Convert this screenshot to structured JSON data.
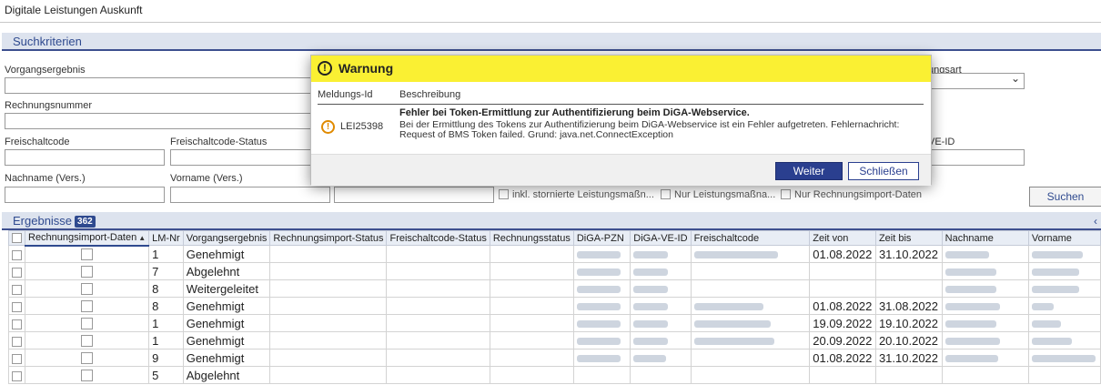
{
  "app": {
    "title": "Digitale Leistungen Auskunft"
  },
  "search": {
    "section_title": "Suchkriterien",
    "fields": {
      "vorgangsergebnis": "Vorgangsergebnis",
      "rechnungsnummer": "Rechnungsnummer",
      "freischaltcode": "Freischaltcode",
      "freischaltcode_status": "Freischaltcode-Status",
      "nachname": "Nachname (Vers.)",
      "vorname": "Vorname (Vers.)",
      "ungsart": "ungsart",
      "ve_id": "VE-ID"
    },
    "options": {
      "storniert": "inkl. stornierte Leistungsmaßn...",
      "nur_leistung": "Nur Leistungsmaßna...",
      "nur_rechnung": "Nur Rechnungsimport-Daten"
    },
    "search_button": "Suchen",
    "search_button_hotkey": "u"
  },
  "results": {
    "title": "Ergebnisse",
    "count": "362",
    "columns": [
      "Rechnungsimport-Daten",
      "LM-Nr",
      "Vorgangsergebnis",
      "Rechnungsimport-Status",
      "Freischaltcode-Status",
      "Rechnungsstatus",
      "DiGA-PZN",
      "DiGA-VE-ID",
      "Freischaltcode",
      "Zeit von",
      "Zeit bis",
      "Nachname",
      "Vorname"
    ],
    "rows": [
      {
        "lm": "1",
        "ergebnis": "Genehmigt",
        "von": "01.08.2022",
        "bis": "31.10.2022"
      },
      {
        "lm": "7",
        "ergebnis": "Abgelehnt",
        "von": "",
        "bis": ""
      },
      {
        "lm": "8",
        "ergebnis": "Weitergeleitet",
        "von": "",
        "bis": ""
      },
      {
        "lm": "8",
        "ergebnis": "Genehmigt",
        "von": "01.08.2022",
        "bis": "31.08.2022"
      },
      {
        "lm": "1",
        "ergebnis": "Genehmigt",
        "von": "19.09.2022",
        "bis": "19.10.2022"
      },
      {
        "lm": "1",
        "ergebnis": "Genehmigt",
        "von": "20.09.2022",
        "bis": "20.10.2022"
      },
      {
        "lm": "9",
        "ergebnis": "Genehmigt",
        "von": "01.08.2022",
        "bis": "31.10.2022"
      },
      {
        "lm": "5",
        "ergebnis": "Abgelehnt",
        "von": "",
        "bis": ""
      }
    ]
  },
  "dialog": {
    "title": "Warnung",
    "col_id": "Meldungs-Id",
    "col_desc": "Beschreibung",
    "message_id": "LEI25398",
    "message_title": "Fehler bei Token-Ermittlung zur Authentifizierung beim DiGA-Webservice.",
    "message_text": "Bei der Ermittlung des Tokens zur Authentifizierung beim DiGA-Webservice ist ein Fehler aufgetreten. Fehlernachricht: Request of BMS Token failed. Grund: java.net.ConnectException",
    "primary_button": "Weiter",
    "secondary_button": "Schließen"
  },
  "colors": {
    "accent": "#2f4a8f",
    "dialog_header": "#faf033",
    "warning_icon": "#e08a00"
  }
}
